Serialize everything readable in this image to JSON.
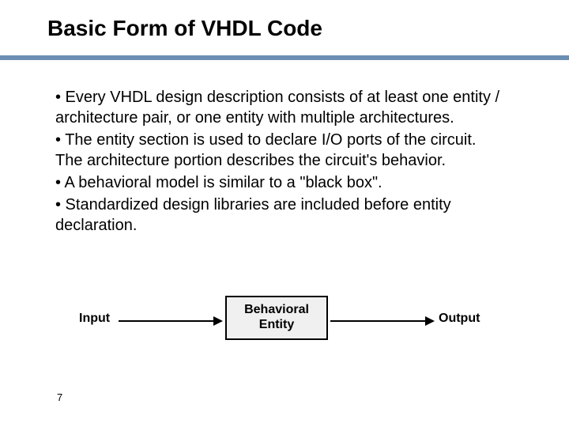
{
  "title": "Basic Form of VHDL Code",
  "bullets": [
    "• Every VHDL design description consists of at least one entity / architecture pair, or one entity with multiple architectures.",
    "• The entity section is used to declare I/O ports of the circuit. The architecture portion describes the circuit's behavior.",
    "• A behavioral model is similar to a \"black box\".",
    "• Standardized design libraries are included before entity declaration."
  ],
  "diagram": {
    "input_label": "Input",
    "box_line1": "Behavioral",
    "box_line2": "Entity",
    "output_label": "Output"
  },
  "page_number": "7"
}
